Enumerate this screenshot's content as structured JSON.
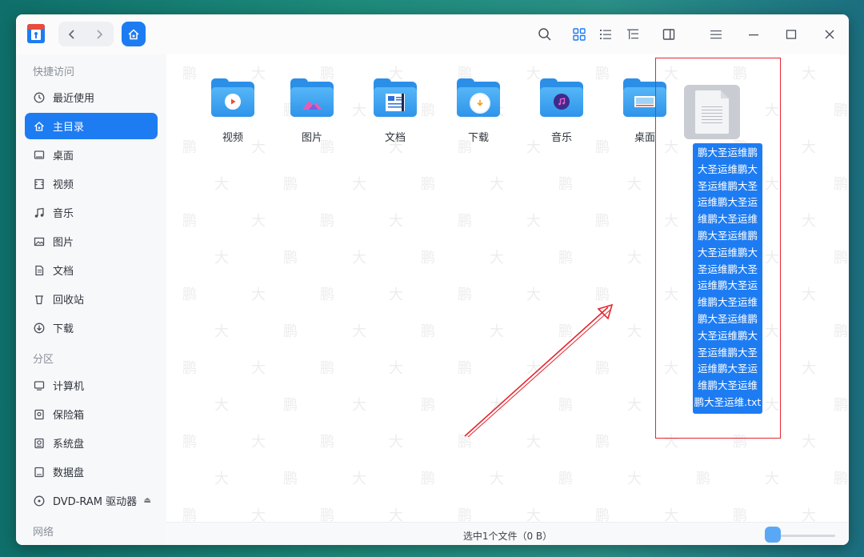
{
  "sidebar": {
    "groups": {
      "quick": "快捷访问",
      "partitions": "分区",
      "network": "网络"
    },
    "items": [
      {
        "label": "最近使用",
        "icon": "clock-icon"
      },
      {
        "label": "主目录",
        "icon": "home-icon"
      },
      {
        "label": "桌面",
        "icon": "desktop-icon"
      },
      {
        "label": "视频",
        "icon": "film-icon"
      },
      {
        "label": "音乐",
        "icon": "music-note-icon"
      },
      {
        "label": "图片",
        "icon": "image-icon"
      },
      {
        "label": "文档",
        "icon": "document-icon"
      },
      {
        "label": "回收站",
        "icon": "trash-icon"
      },
      {
        "label": "下载",
        "icon": "download-icon"
      },
      {
        "label": "计算机",
        "icon": "monitor-icon"
      },
      {
        "label": "保险箱",
        "icon": "safe-icon"
      },
      {
        "label": "系统盘",
        "icon": "disk-icon"
      },
      {
        "label": "数据盘",
        "icon": "drive-icon"
      },
      {
        "label": "DVD-RAM 驱动器",
        "icon": "optical-disc-icon"
      }
    ]
  },
  "files": [
    {
      "name": "视频",
      "icon": "video-folder-icon"
    },
    {
      "name": "图片",
      "icon": "pictures-folder-icon"
    },
    {
      "name": "文档",
      "icon": "documents-folder-icon"
    },
    {
      "name": "下载",
      "icon": "downloads-folder-icon"
    },
    {
      "name": "音乐",
      "icon": "music-folder-icon"
    },
    {
      "name": "桌面",
      "icon": "desktop-folder-icon"
    },
    {
      "name": "鹏大圣运维鹏大圣运维鹏大圣运维鹏大圣运维鹏大圣运维鹏大圣运维鹏大圣运维鹏大圣运维鹏大圣运维鹏大圣运维鹏大圣运维鹏大圣运维鹏大圣运维鹏大圣运维鹏大圣运维鹏大圣运维鹏大圣运维鹏大圣运维鹏大圣运维.txt",
      "icon": "text-file-icon",
      "selected": true
    }
  ],
  "status": {
    "text": "选中1个文件（0 B）"
  },
  "icon_size_level": 0,
  "watermark_chars": [
    "鹏",
    "大"
  ],
  "colors": {
    "accent": "#1e7cf2",
    "annotation": "#e5262e"
  }
}
